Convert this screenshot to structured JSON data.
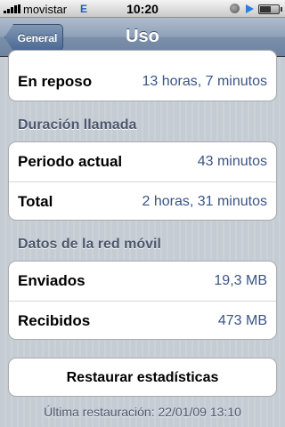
{
  "status_bar": {
    "carrier": "movistar",
    "network": "E",
    "time": "10:20"
  },
  "nav": {
    "back_label": "General",
    "title": "Uso"
  },
  "standby": {
    "label": "En reposo",
    "value": "13 horas, 7 minutos"
  },
  "call_duration": {
    "header": "Duración llamada",
    "rows": [
      {
        "label": "Periodo actual",
        "value": "43 minutos"
      },
      {
        "label": "Total",
        "value": "2 horas, 31 minutos"
      }
    ]
  },
  "mobile_data": {
    "header": "Datos de la red móvil",
    "rows": [
      {
        "label": "Enviados",
        "value": "19,3 MB"
      },
      {
        "label": "Recibidos",
        "value": "473 MB"
      }
    ]
  },
  "reset": {
    "button_label": "Restaurar estadísticas",
    "last_reset": "Última restauración: 22/01/09 13:10"
  }
}
